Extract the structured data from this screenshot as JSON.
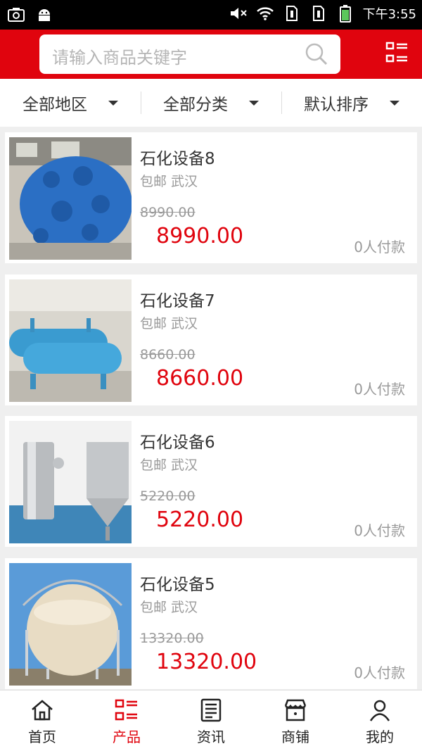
{
  "status_bar": {
    "time": "下午3:55"
  },
  "search": {
    "placeholder": "请输入商品关键字"
  },
  "filters": [
    {
      "label": "全部地区"
    },
    {
      "label": "全部分类"
    },
    {
      "label": "默认排序"
    }
  ],
  "products": [
    {
      "title": "石化设备8",
      "meta": "包邮 武汉",
      "original_price": "8990.00",
      "price": "8990.00",
      "paid": "0人付款"
    },
    {
      "title": "石化设备7",
      "meta": "包邮 武汉",
      "original_price": "8660.00",
      "price": "8660.00",
      "paid": "0人付款"
    },
    {
      "title": "石化设备6",
      "meta": "包邮 武汉",
      "original_price": "5220.00",
      "price": "5220.00",
      "paid": "0人付款"
    },
    {
      "title": "石化设备5",
      "meta": "包邮 武汉",
      "original_price": "13320.00",
      "price": "13320.00",
      "paid": "0人付款"
    }
  ],
  "tabs": [
    {
      "label": "首页",
      "icon": "home-icon"
    },
    {
      "label": "产品",
      "icon": "product-list-icon",
      "active": true
    },
    {
      "label": "资讯",
      "icon": "news-icon"
    },
    {
      "label": "商铺",
      "icon": "shop-icon"
    },
    {
      "label": "我的",
      "icon": "user-icon"
    }
  ],
  "colors": {
    "brand_red": "#e0040e",
    "price_red": "#e0040e",
    "text_gray": "#999999"
  }
}
